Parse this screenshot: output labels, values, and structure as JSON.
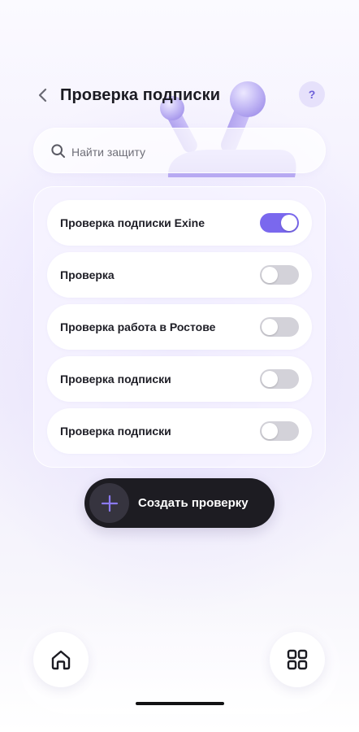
{
  "header": {
    "title": "Проверка подписки",
    "back_icon": "chevron-left-icon",
    "help_label": "?"
  },
  "search": {
    "placeholder": "Найти защиту",
    "value": "",
    "icon": "search-icon"
  },
  "checks": [
    {
      "label": "Проверка подписки Exine",
      "enabled": true
    },
    {
      "label": "Проверка",
      "enabled": false
    },
    {
      "label": "Проверка работа в Ростове",
      "enabled": false
    },
    {
      "label": "Проверка подписки",
      "enabled": false
    },
    {
      "label": "Проверка подписки",
      "enabled": false
    }
  ],
  "create_button": {
    "label": "Создать проверку",
    "icon": "plus-icon"
  },
  "bottom_nav": {
    "home_icon": "home-icon",
    "apps_icon": "grid-icon"
  },
  "colors": {
    "accent": "#7a68ee",
    "toggle_off": "#d3d2d9",
    "dark_button": "#1d1c22",
    "help_bg": "#e6e1fb"
  }
}
